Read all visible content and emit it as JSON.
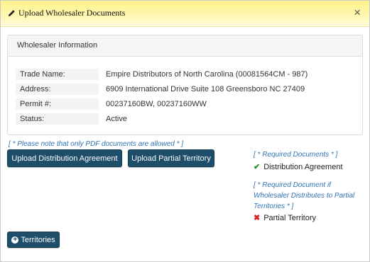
{
  "modal": {
    "title": "Upload Wholesaler Documents",
    "close_label": "×"
  },
  "panel": {
    "heading": "Wholesaler Information",
    "rows": [
      {
        "label": "Trade Name:",
        "value": "Empire Distributors of North Carolina (00081564CM - 987)"
      },
      {
        "label": "Address:",
        "value": "6909 International Drive Suite 108 Greensboro NC 27409"
      },
      {
        "label": "Permit #:",
        "value": "00237160BW, 00237160WW"
      },
      {
        "label": "Status:",
        "value": "Active"
      }
    ]
  },
  "note": "[ * Please note that only PDF documents are allowed * ]",
  "buttons": {
    "upload_distribution": "Upload Distribution Agreement",
    "upload_partial": "Upload Partial Territory",
    "territories": "Territories"
  },
  "requirements": {
    "required_title": "[ * Required Documents * ]",
    "distribution_item": "Distribution Agreement",
    "conditional_title_line1": "[ * Required Document if",
    "conditional_title_line2": "Wholesaler Distributes to Partial",
    "conditional_title_line3": "Territories * ]",
    "partial_item": "Partial Territory"
  },
  "colors": {
    "header_yellow": "#fff38a",
    "button_bg": "#1f4e6b",
    "note_blue": "#2f74b5",
    "check_green": "#2a8a2a",
    "x_red": "#d42020"
  },
  "icons": {
    "title_icon": "pencil-icon",
    "close_icon": "close-icon",
    "complete_icon": "check-icon",
    "missing_icon": "x-icon",
    "territories_icon": "plus-circle-icon"
  }
}
